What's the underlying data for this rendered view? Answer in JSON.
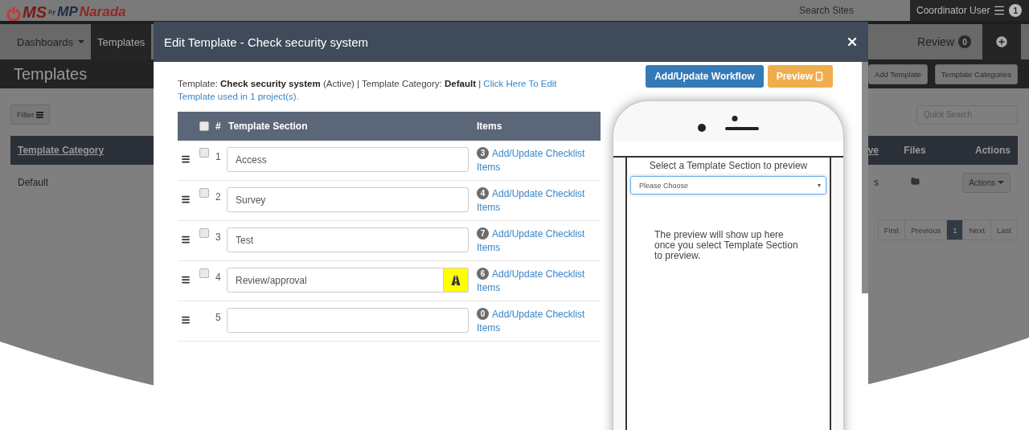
{
  "topbar": {
    "logo": {
      "brand": "MS",
      "by": "by",
      "partner_prefix": "MP",
      "partner_name": "Narada"
    },
    "search_label": "Search Sites",
    "user": "Coordinator User",
    "notification_count": "1"
  },
  "nav": {
    "tabs": [
      {
        "label": "Dashboards",
        "selected": false,
        "dropdown": true
      },
      {
        "label": "Templates",
        "selected": true,
        "dropdown": false
      }
    ],
    "review": {
      "label": "Review",
      "count": "0"
    }
  },
  "page": {
    "title": "Templates",
    "buttons": [
      "Add Template",
      "Template Categories"
    ],
    "filter_label": "Filter",
    "quick_search": {
      "placeholder": "Quick Search"
    },
    "table": {
      "columns": [
        "Template Category",
        "ve",
        "Files",
        "Actions"
      ],
      "rows": [
        {
          "category": "Default",
          "column_2": "s",
          "actions": "Actions"
        }
      ]
    },
    "pagination": [
      {
        "label": "First",
        "selected": false
      },
      {
        "label": "Previous",
        "selected": false
      },
      {
        "label": "1",
        "selected": true
      },
      {
        "label": "Next",
        "selected": false
      },
      {
        "label": "Last",
        "selected": false
      }
    ]
  },
  "modal": {
    "title": "Edit Template - Check security system",
    "info": "Template: **Check security system** (Active) | Template Category: **Default** |",
    "edit_link": "Click Here To Edit",
    "usage_link": "Template used in 1 project(s).",
    "buttons": [
      {
        "label": "Add/Update Workflow",
        "kind": "primary"
      },
      {
        "label": "Preview",
        "kind": "preview"
      }
    ],
    "table": {
      "all_checked": false,
      "columns": [
        "#",
        "Template Section",
        "Items"
      ],
      "rows": [
        {
          "number": "1",
          "section": "Access",
          "checked": false,
          "flagged": false,
          "item_count": "3",
          "link": "Add/Update Checklist Items"
        },
        {
          "number": "2",
          "section": "Survey",
          "checked": false,
          "flagged": false,
          "item_count": "4",
          "link": "Add/Update Checklist Items"
        },
        {
          "number": "3",
          "section": "Test",
          "checked": false,
          "flagged": false,
          "item_count": "7",
          "link": "Add/Update Checklist Items"
        },
        {
          "number": "4",
          "section": "Review/approval",
          "checked": false,
          "flagged": true,
          "item_count": "6",
          "link": "Add/Update Checklist Items"
        },
        {
          "number": "5",
          "section": "",
          "flagged": false,
          "item_count": "0",
          "link": "Add/Update Checklist Items"
        }
      ]
    },
    "preview": {
      "heading": "Select a Template Section to preview",
      "select": {
        "value": "Please Choose"
      },
      "message": "The preview will show up here once you select Template Section to preview."
    }
  }
}
